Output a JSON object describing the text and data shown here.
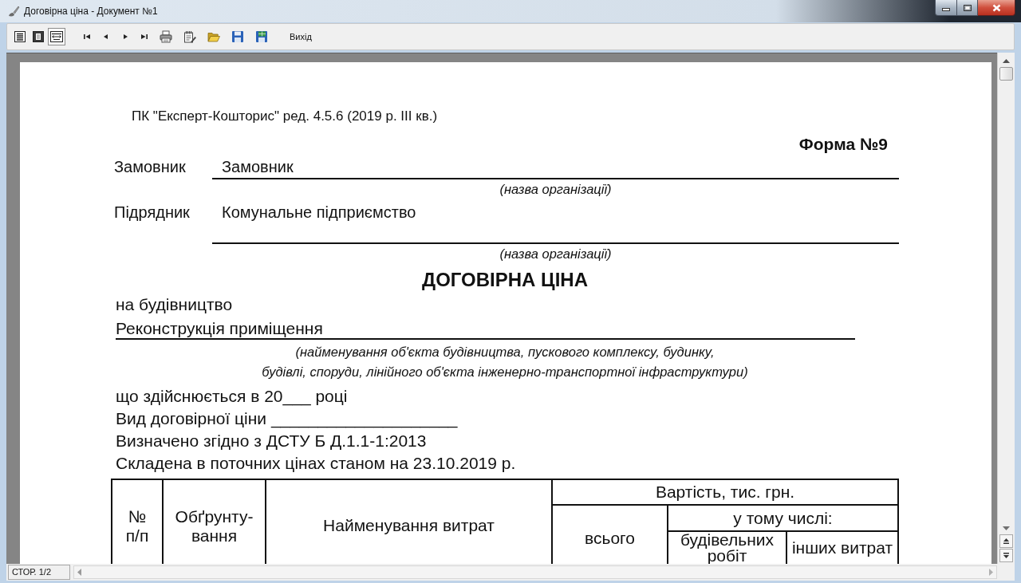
{
  "window": {
    "title": "Договірна ціна - Документ №1"
  },
  "toolbar": {
    "view_modes": [
      {
        "selected": false
      },
      {
        "selected": false
      },
      {
        "selected": true
      }
    ],
    "exit": "Вихід"
  },
  "document": {
    "program_line": "ПК \"Експерт-Кошторис\" ред. 4.5.6 (2019 р. III кв.)",
    "form_number": "Форма №9",
    "parties": [
      {
        "label": "Замовник",
        "value": "Замовник",
        "hint": "(назва організації)"
      },
      {
        "label": "Підрядник",
        "value": "Комунальне підприємство",
        "hint": "(назва організації)"
      }
    ],
    "title": "ДОГОВІРНА ЦІНА",
    "construction_intro": "на будівництво",
    "object_name": "Реконструкція приміщення",
    "object_hint": [
      "(найменування об'єкта будівництва, пускового комплексу, будинку,",
      "будівлі, споруди, лінійного об'єкта інженерно-транспортної інфраструктури)"
    ],
    "details": [
      "що здійснюється в 20___ році",
      "Вид договірної ціни ____________________",
      "Визначено згідно з ДСТУ Б Д.1.1-1:2013",
      "Складена в поточних цінах станом на 23.10.2019 р."
    ],
    "table": {
      "columns": {
        "number": "№ п/п",
        "basis": "Обґрунту-вання",
        "name": "Найменування витрат",
        "cost": "Вартість, тис. грн.",
        "total": "всього",
        "including": "у тому числі:",
        "construction": "будівельних робіт",
        "other": "інших витрат"
      }
    }
  },
  "status_bar": {
    "page": "СТОР. 1/2"
  }
}
